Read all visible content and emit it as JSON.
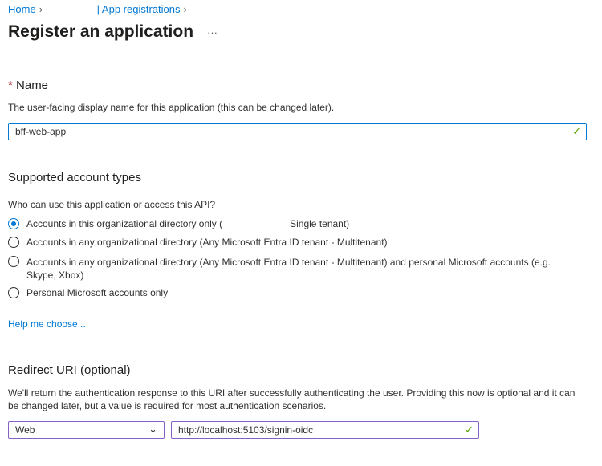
{
  "breadcrumb": {
    "home": "Home",
    "app_registrations": "| App registrations"
  },
  "page": {
    "title": "Register an application",
    "more": "···"
  },
  "name_section": {
    "required_marker": "*",
    "title": "Name",
    "description": "The user-facing display name for this application (this can be changed later).",
    "value": "bff-web-app"
  },
  "account_types": {
    "title": "Supported account types",
    "question": "Who can use this application or access this API?",
    "options": [
      {
        "label": "Accounts in this organizational directory only (",
        "suffix": "Single tenant)",
        "selected": true
      },
      {
        "label": "Accounts in any organizational directory (Any Microsoft Entra ID tenant - Multitenant)",
        "selected": false
      },
      {
        "label": "Accounts in any organizational directory (Any Microsoft Entra ID tenant - Multitenant) and personal Microsoft accounts (e.g. Skype, Xbox)",
        "selected": false
      },
      {
        "label": "Personal Microsoft accounts only",
        "selected": false
      }
    ],
    "help_link": "Help me choose..."
  },
  "redirect": {
    "title": "Redirect URI (optional)",
    "description": "We'll return the authentication response to this URI after successfully authenticating the user. Providing this now is optional and it can be changed later, but a value is required for most authentication scenarios.",
    "platform": "Web",
    "uri": "http://localhost:5103/signin-oidc"
  }
}
